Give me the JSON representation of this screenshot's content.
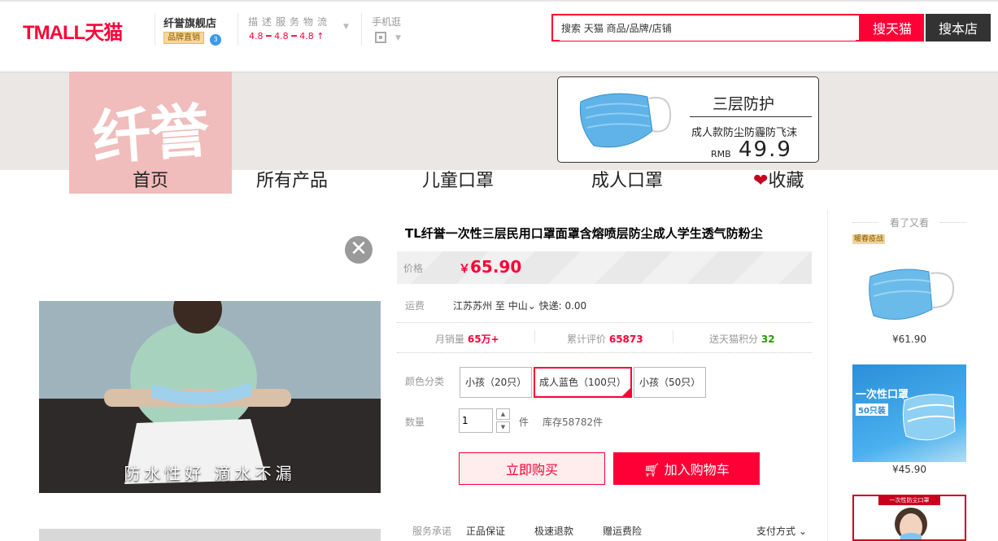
{
  "header": {
    "logo": "TMALL天猫",
    "shop_name": "纤誉旗舰店",
    "brand_tag": "品牌直销",
    "rating_label": "描述服务物流",
    "rating_values": "4.8 ━ 4.8 ━ 4.8 ↑",
    "mobile_label": "手机逛",
    "search_placeholder": "搜索 天猫 商品/品牌/店铺",
    "search_tmall_button": "搜天猫",
    "search_shop_button": "搜本店"
  },
  "shop_banner": {
    "logo_text": "纤誉",
    "ad_title": "三层防护",
    "ad_subtitle": "成人款防尘防霾防飞沫",
    "ad_currency": "RMB",
    "ad_price": "49.9",
    "nav": [
      "首页",
      "所有产品",
      "儿童口罩",
      "成人口罩",
      "收藏"
    ]
  },
  "gallery": {
    "video_caption": "防水性好  滴水不漏"
  },
  "product": {
    "title": "TL纤誉一次性三层民用口罩面罩含熔喷层防尘成人学生透气防粉尘",
    "price_label": "价格",
    "currency": "￥",
    "price": "65.90",
    "shipping_label": "运费",
    "shipping_from": "江苏苏州",
    "shipping_to_word": "至",
    "shipping_to": "中山",
    "shipping_method": "快递: 0.00",
    "stats": [
      {
        "label": "月销量",
        "value": "65万+"
      },
      {
        "label": "累计评价",
        "value": "65873"
      },
      {
        "label": "送天猫积分",
        "value": "32"
      }
    ],
    "color_label": "颜色分类",
    "skus": [
      "小孩（20只）",
      "成人蓝色（100只）",
      "小孩（50只）"
    ],
    "selected_sku": "成人蓝色（100只）",
    "quantity_label": "数量",
    "quantity": "1",
    "unit": "件",
    "stock": "库存58782件",
    "buy_now": "立即购买",
    "add_to_cart": "加入购物车",
    "service_label": "服务承诺",
    "services": [
      "正品保证",
      "极速退款",
      "赠运费险"
    ],
    "payment_label": "支付方式"
  },
  "sidebar": {
    "title": "看了又看",
    "tag": "暖春疫战",
    "items": [
      {
        "price": "¥61.90"
      },
      {
        "price": "¥45.90",
        "title": "一次性口罩",
        "badge": "50只装"
      },
      {
        "tag": "一次性防尘口罩"
      }
    ]
  },
  "colors": {
    "tmall_red": "#ff0036",
    "dark": "#333333",
    "banner_bg": "#ebe7e4",
    "logo_pink": "#f0bcbc"
  }
}
